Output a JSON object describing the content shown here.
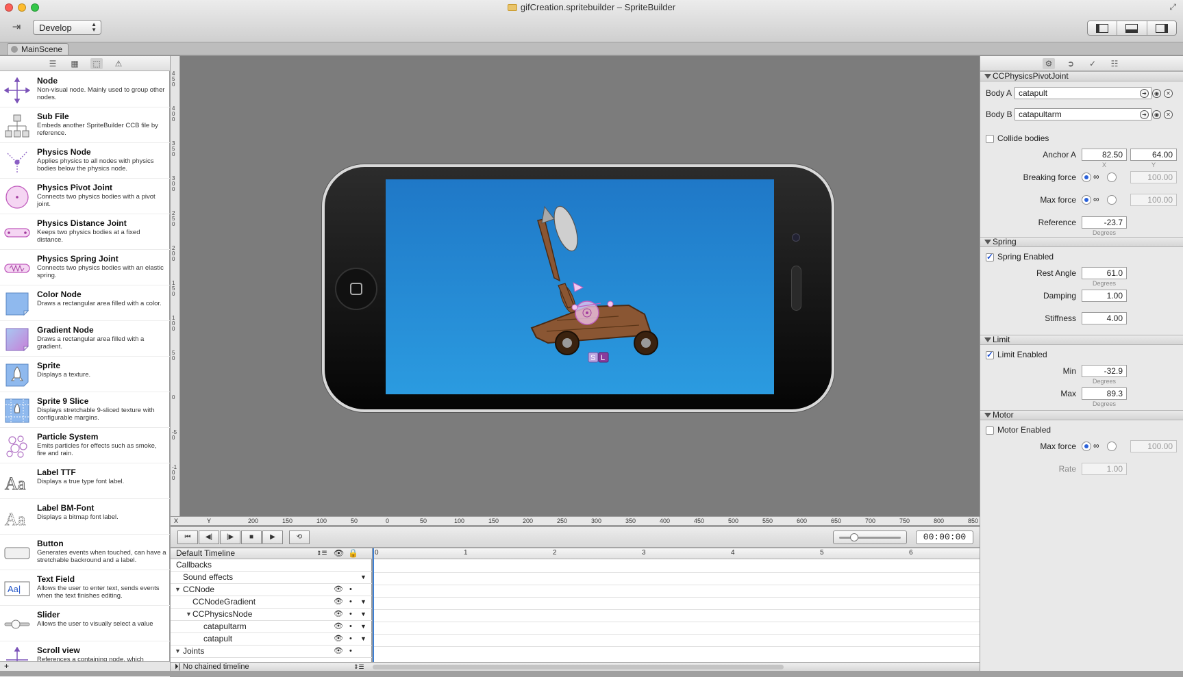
{
  "window": {
    "title": "gifCreation.spritebuilder – SpriteBuilder"
  },
  "toolbar": {
    "mode": "Develop"
  },
  "tabs": [
    {
      "label": "MainScene"
    }
  ],
  "library": {
    "items": [
      {
        "name": "Node",
        "desc": "Non-visual node. Mainly used to group other nodes.",
        "icon": "node-icon"
      },
      {
        "name": "Sub File",
        "desc": "Embeds another SpriteBuilder CCB file by reference.",
        "icon": "sub-file-icon"
      },
      {
        "name": "Physics Node",
        "desc": "Applies physics to all nodes with physics bodies below the physics node.",
        "icon": "physics-node-icon"
      },
      {
        "name": "Physics Pivot Joint",
        "desc": "Connects two physics bodies with a pivot joint.",
        "icon": "pivot-joint-icon"
      },
      {
        "name": "Physics Distance Joint",
        "desc": "Keeps two physics bodies at a fixed distance.",
        "icon": "distance-joint-icon"
      },
      {
        "name": "Physics Spring Joint",
        "desc": "Connects two physics bodies with an elastic spring.",
        "icon": "spring-joint-icon"
      },
      {
        "name": "Color Node",
        "desc": "Draws a rectangular area filled with a color.",
        "icon": "color-node-icon"
      },
      {
        "name": "Gradient Node",
        "desc": "Draws a rectangular area filled with a gradient.",
        "icon": "gradient-node-icon"
      },
      {
        "name": "Sprite",
        "desc": "Displays a texture.",
        "icon": "sprite-icon"
      },
      {
        "name": "Sprite 9 Slice",
        "desc": "Displays stretchable 9-sliced texture with configurable margins.",
        "icon": "sprite-9-slice-icon"
      },
      {
        "name": "Particle System",
        "desc": "Emits particles for effects such as smoke, fire and rain.",
        "icon": "particle-system-icon"
      },
      {
        "name": "Label TTF",
        "desc": "Displays a true type font label.",
        "icon": "label-ttf-icon"
      },
      {
        "name": "Label BM-Font",
        "desc": "Displays a bitmap font label.",
        "icon": "label-bmfont-icon"
      },
      {
        "name": "Button",
        "desc": "Generates events when touched, can have a stretchable backround and a label.",
        "icon": "button-icon"
      },
      {
        "name": "Text Field",
        "desc": "Allows the user to enter text, sends events when the text finishes editing.",
        "icon": "text-field-icon"
      },
      {
        "name": "Slider",
        "desc": "Allows the user to visually select a value",
        "icon": "slider-icon"
      },
      {
        "name": "Scroll view",
        "desc": "References a containing node, which",
        "icon": "scroll-view-icon"
      }
    ]
  },
  "rulers": {
    "vertical": [
      "450",
      "400",
      "350",
      "300",
      "250",
      "200",
      "150",
      "100",
      "50",
      "0",
      "-50",
      "-100"
    ],
    "horizontal_axis_x": "X",
    "horizontal_axis_y": "Y",
    "horizontal": [
      "200",
      "150",
      "100",
      "50",
      "0",
      "50",
      "100",
      "150",
      "200",
      "250",
      "300",
      "350",
      "400",
      "450",
      "500",
      "550",
      "600",
      "650",
      "700",
      "750",
      "800",
      "850"
    ]
  },
  "canvas": {
    "badge_s": "S",
    "badge_l": "L"
  },
  "inspector": {
    "title": "CCPhysicsPivotJoint",
    "body_a_label": "Body A",
    "body_a": "catapult",
    "body_b_label": "Body B",
    "body_b": "catapultarm",
    "collide_label": "Collide bodies",
    "collide": false,
    "anchor_label": "Anchor A",
    "anchor_x": "82.50",
    "anchor_y": "64.00",
    "anchor_x_unit": "X",
    "anchor_y_unit": "Y",
    "breaking_label": "Breaking force",
    "breaking_value": "100.00",
    "maxforce_label": "Max force",
    "maxforce_value": "100.00",
    "infinity": "∞",
    "reference_label": "Reference",
    "reference_value": "-23.7",
    "degrees": "Degrees",
    "spring": {
      "title": "Spring",
      "enabled_label": "Spring Enabled",
      "enabled": true,
      "rest_label": "Rest Angle",
      "rest_value": "61.0",
      "damping_label": "Damping",
      "damping_value": "1.00",
      "stiffness_label": "Stiffness",
      "stiffness_value": "4.00"
    },
    "limit": {
      "title": "Limit",
      "enabled_label": "Limit Enabled",
      "enabled": true,
      "min_label": "Min",
      "min_value": "-32.9",
      "max_label": "Max",
      "max_value": "89.3"
    },
    "motor": {
      "title": "Motor",
      "enabled_label": "Motor Enabled",
      "enabled": false,
      "maxforce_label": "Max force",
      "maxforce_value": "100.00",
      "rate_label": "Rate",
      "rate_value": "1.00"
    }
  },
  "timeline": {
    "name": "Default Timeline",
    "time": "00:00:00",
    "ticks": [
      "0",
      "1",
      "2",
      "3",
      "4",
      "5",
      "6"
    ],
    "rows": [
      {
        "label": "Callbacks",
        "depth": 0,
        "toggle": ""
      },
      {
        "label": "Sound effects",
        "depth": 0,
        "toggle": ""
      },
      {
        "label": "CCNode",
        "depth": 0,
        "toggle": "▼"
      },
      {
        "label": "CCNodeGradient",
        "depth": 1,
        "toggle": ""
      },
      {
        "label": "CCPhysicsNode",
        "depth": 1,
        "toggle": "▼"
      },
      {
        "label": "catapultarm",
        "depth": 2,
        "toggle": ""
      },
      {
        "label": "catapult",
        "depth": 2,
        "toggle": ""
      },
      {
        "label": "Joints",
        "depth": 0,
        "toggle": "▼"
      }
    ],
    "chained": "No chained timeline"
  }
}
